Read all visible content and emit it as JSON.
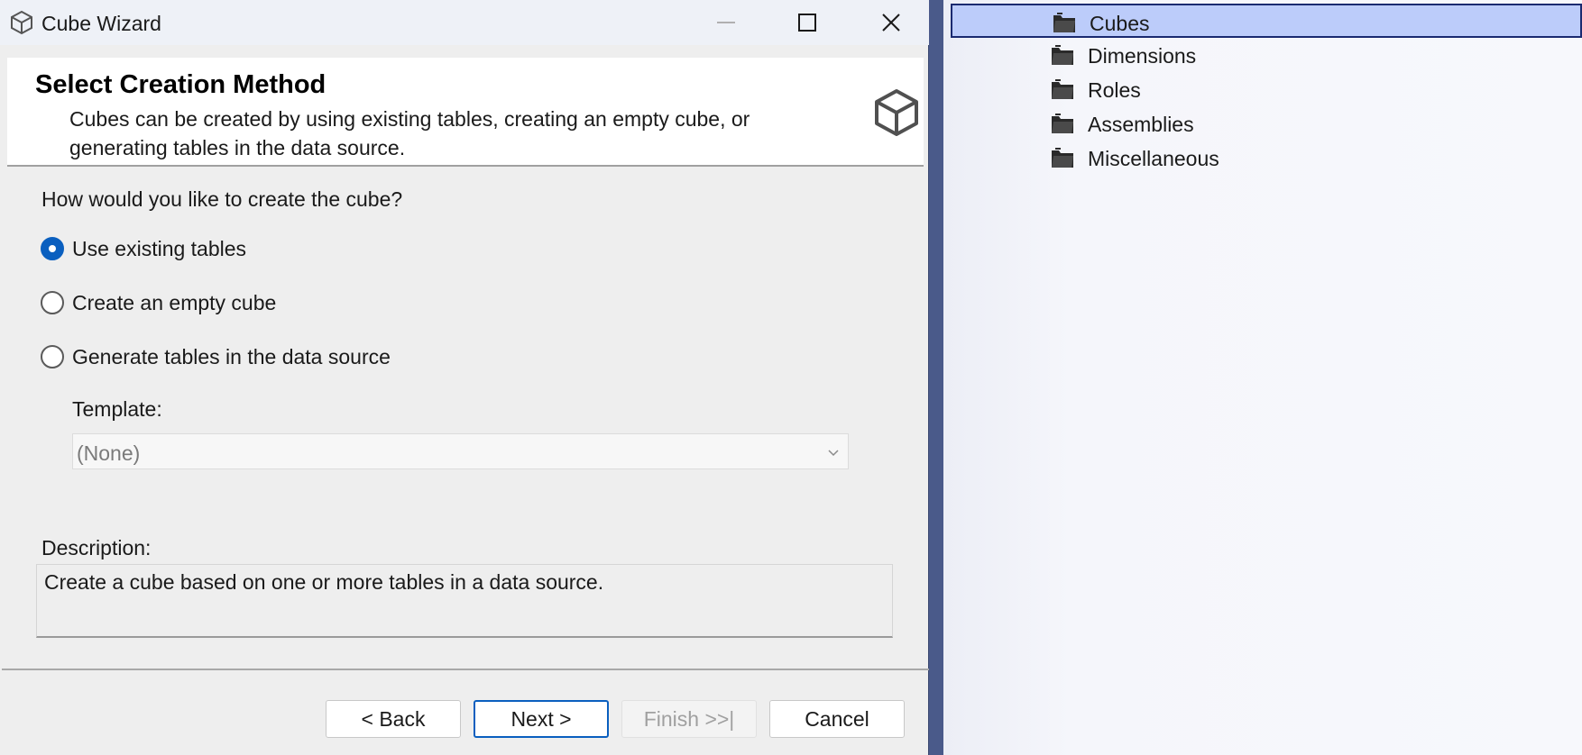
{
  "window": {
    "title": "Cube Wizard",
    "controls": {
      "minimize": "minimize-icon",
      "maximize": "maximize-icon",
      "close": "close-icon"
    }
  },
  "header": {
    "title": "Select Creation Method",
    "description": "Cubes can be created by using existing tables, creating an empty cube, or generating tables in the data source.",
    "icon": "cube-icon"
  },
  "question": "How would you like to create the cube?",
  "options": [
    {
      "label": "Use existing tables",
      "checked": true
    },
    {
      "label": "Create an empty cube",
      "checked": false
    },
    {
      "label": "Generate tables in the data source",
      "checked": false
    }
  ],
  "template": {
    "label": "Template:",
    "value": "(None)",
    "enabled": false
  },
  "description": {
    "label": "Description:",
    "text": "Create a cube based on one or more tables in a data source."
  },
  "buttons": {
    "back": "< Back",
    "next": "Next >",
    "finish": "Finish >>|",
    "cancel": "Cancel"
  },
  "explorer": {
    "items": [
      {
        "label": "Cubes",
        "selected": true,
        "icon": "folder-icon"
      },
      {
        "label": "Dimensions",
        "selected": false,
        "icon": "folder-icon"
      },
      {
        "label": "Roles",
        "selected": false,
        "icon": "folder-icon"
      },
      {
        "label": "Assemblies",
        "selected": false,
        "icon": "folder-icon"
      },
      {
        "label": "Miscellaneous",
        "selected": false,
        "icon": "folder-icon"
      }
    ]
  },
  "colors": {
    "accent": "#0a5fbf",
    "selection": "#bcccfa",
    "selection_border": "#1a2a70",
    "frame": "#4a5a8a"
  }
}
